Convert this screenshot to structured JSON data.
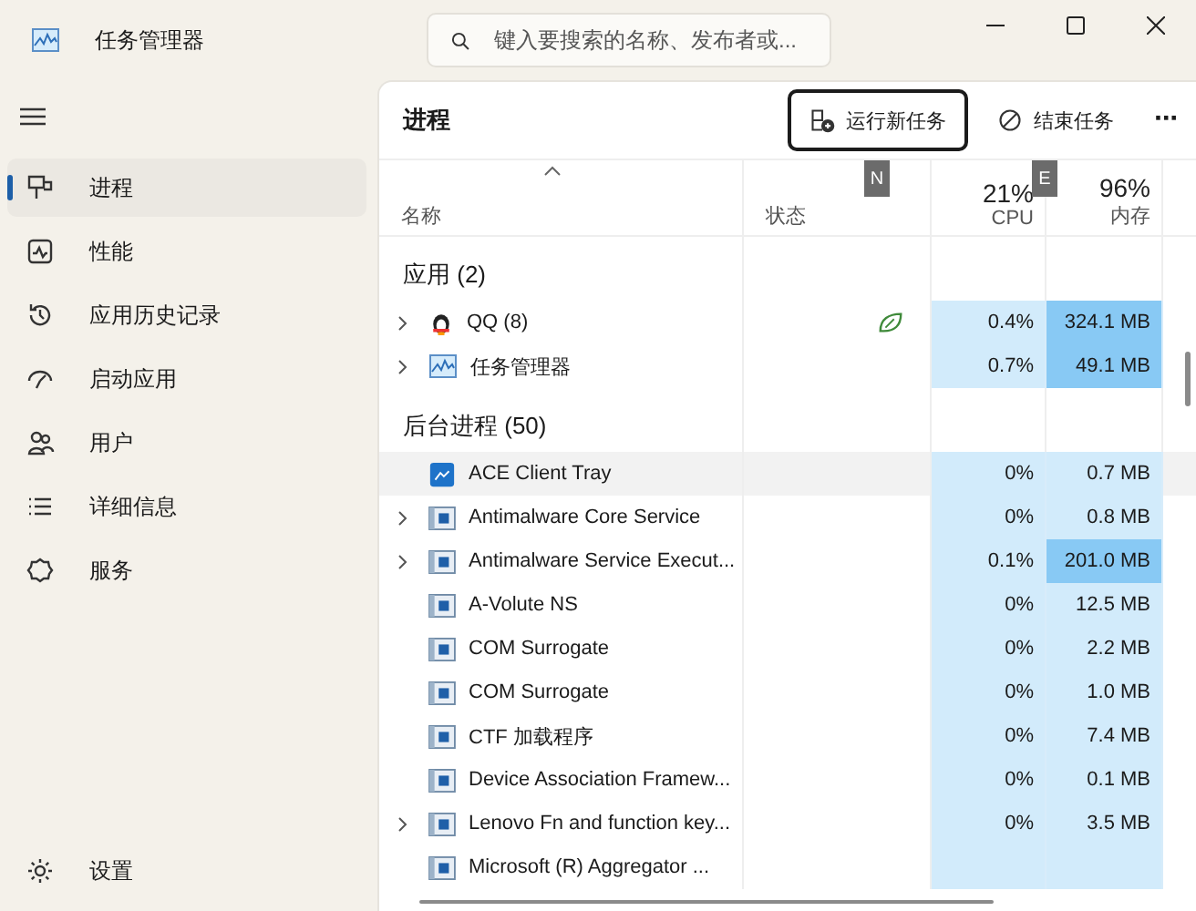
{
  "window": {
    "title": "任务管理器"
  },
  "search": {
    "placeholder": "键入要搜索的名称、发布者或..."
  },
  "sidebar": {
    "items": [
      {
        "label": "进程",
        "kind": "processes",
        "selected": true
      },
      {
        "label": "性能",
        "kind": "performance",
        "selected": false
      },
      {
        "label": "应用历史记录",
        "kind": "history",
        "selected": false
      },
      {
        "label": "启动应用",
        "kind": "startup",
        "selected": false
      },
      {
        "label": "用户",
        "kind": "users",
        "selected": false
      },
      {
        "label": "详细信息",
        "kind": "details",
        "selected": false
      },
      {
        "label": "服务",
        "kind": "services",
        "selected": false
      }
    ],
    "footer": {
      "label": "设置"
    }
  },
  "page": {
    "title": "进程",
    "buttons": [
      {
        "label": "运行新任务",
        "focused": true
      },
      {
        "label": "结束任务",
        "focused": false
      }
    ],
    "more": "···"
  },
  "table": {
    "columns": [
      {
        "label": "名称",
        "caret": true
      },
      {
        "label": "状态",
        "key_hint": "N"
      },
      {
        "total": "21%",
        "label": "CPU",
        "key_hint": "E"
      },
      {
        "total": "96%",
        "label": "内存"
      }
    ],
    "groups": [
      {
        "title": "应用 (2)",
        "rows": [
          {
            "name": "QQ (8)",
            "kind": "penguin",
            "expandable": true,
            "efficiency": true,
            "selected": false,
            "cpu": "0.4%",
            "mem": "324.1 MB",
            "mem_high": true
          },
          {
            "name": "任务管理器",
            "kind": "monitor",
            "expandable": true,
            "efficiency": false,
            "selected": false,
            "cpu": "0.7%",
            "mem": "49.1 MB",
            "mem_high": true
          }
        ]
      },
      {
        "title": "后台进程 (50)",
        "rows": [
          {
            "name": "ACE Client Tray",
            "kind": "tray",
            "expandable": false,
            "efficiency": false,
            "selected": true,
            "cpu": "0%",
            "mem": "0.7 MB",
            "mem_high": false
          },
          {
            "name": "Antimalware Core Service",
            "kind": "app",
            "expandable": true,
            "efficiency": false,
            "selected": false,
            "cpu": "0%",
            "mem": "0.8 MB",
            "mem_high": false
          },
          {
            "name": "Antimalware Service Execut...",
            "kind": "app",
            "expandable": true,
            "efficiency": false,
            "selected": false,
            "cpu": "0.1%",
            "mem": "201.0 MB",
            "mem_high": true
          },
          {
            "name": "A-Volute NS",
            "kind": "app",
            "expandable": false,
            "efficiency": false,
            "selected": false,
            "cpu": "0%",
            "mem": "12.5 MB",
            "mem_high": false
          },
          {
            "name": "COM Surrogate",
            "kind": "app",
            "expandable": false,
            "efficiency": false,
            "selected": false,
            "cpu": "0%",
            "mem": "2.2 MB",
            "mem_high": false
          },
          {
            "name": "COM Surrogate",
            "kind": "app",
            "expandable": false,
            "efficiency": false,
            "selected": false,
            "cpu": "0%",
            "mem": "1.0 MB",
            "mem_high": false
          },
          {
            "name": "CTF 加载程序",
            "kind": "app",
            "expandable": false,
            "efficiency": false,
            "selected": false,
            "cpu": "0%",
            "mem": "7.4 MB",
            "mem_high": false
          },
          {
            "name": "Device Association Framew...",
            "kind": "app",
            "expandable": false,
            "efficiency": false,
            "selected": false,
            "cpu": "0%",
            "mem": "0.1 MB",
            "mem_high": false
          },
          {
            "name": "Lenovo Fn and function key...",
            "kind": "app",
            "expandable": true,
            "efficiency": false,
            "selected": false,
            "cpu": "0%",
            "mem": "3.5 MB",
            "mem_high": false
          },
          {
            "name": "Microsoft (R) Aggregator ...",
            "kind": "app",
            "expandable": false,
            "efficiency": false,
            "selected": false
          }
        ]
      }
    ]
  }
}
